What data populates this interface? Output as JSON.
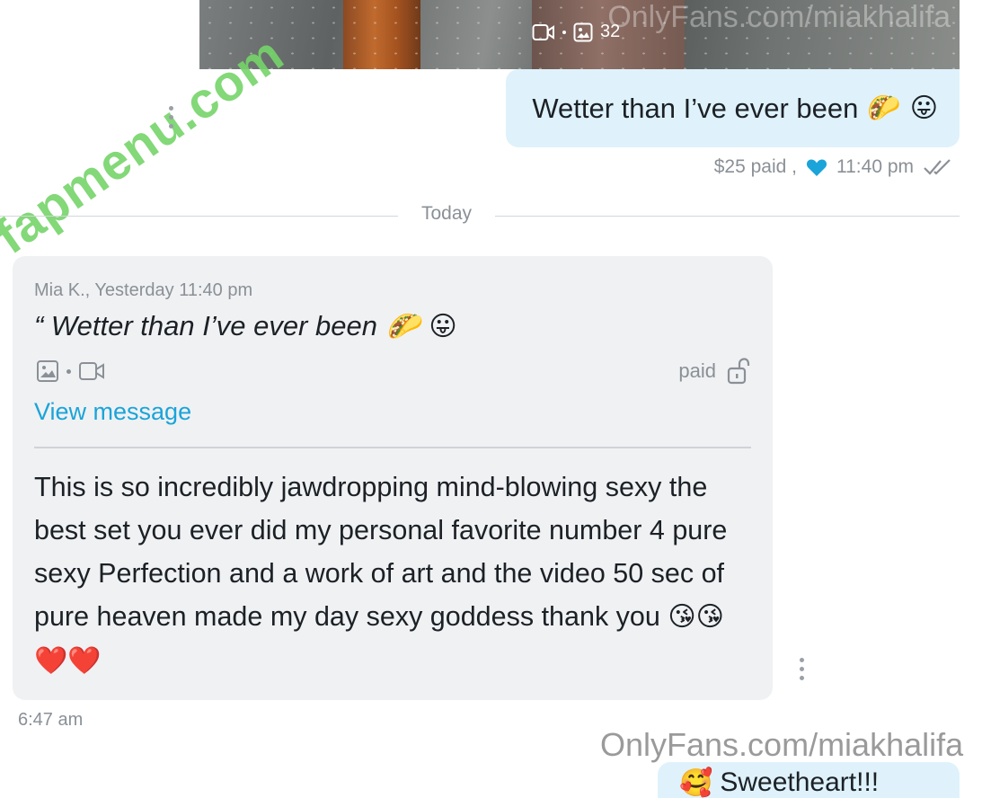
{
  "preview": {
    "media_count": "32",
    "watermark": "OnlyFans.com/miakhalifa"
  },
  "site_watermark": "fapmenu.com",
  "sent": {
    "text": "Wetter than I’ve ever been",
    "emojis": [
      "🌮",
      "😛"
    ],
    "price": "$25 paid ,",
    "time": "11:40 pm"
  },
  "divider": {
    "label": "Today"
  },
  "received": {
    "quote_meta": "Mia K., Yesterday 11:40 pm",
    "quote_text": "“ Wetter than I’ve ever been",
    "quote_emojis": [
      "🌮",
      "😛"
    ],
    "paid_label": "paid",
    "view_label": "View message",
    "body": "This is so incredibly jawdropping mind-blowing sexy the best set you ever did my personal favorite number 4 pure sexy Perfection and a work of art and the video 50 sec of pure heaven made my day sexy goddess thank you",
    "body_emojis": [
      "😘",
      "😘",
      "❤️",
      "❤️"
    ],
    "time": "6:47 am"
  },
  "onlyfans_watermark": "OnlyFans.com/miakhalifa",
  "next_bubble": {
    "emoji": "🥰",
    "text": "Sweetheart!!!"
  },
  "colors": {
    "sent_bubble": "#dff2fb",
    "received_card": "#f0f1f3",
    "link": "#1aa4d9",
    "meta_text": "#8a9096",
    "heart": "#1aa4d9"
  }
}
